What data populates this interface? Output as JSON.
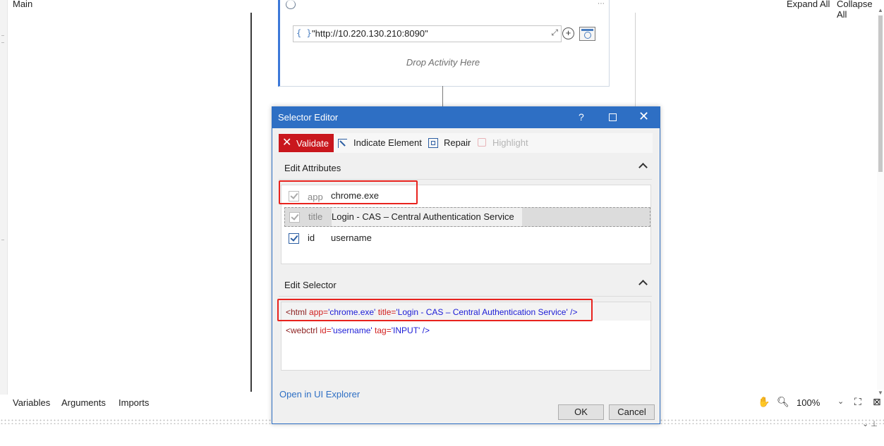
{
  "designer": {
    "title": "Main",
    "expand_all": "Expand All",
    "collapse_all": "Collapse All",
    "url_value": "\"http://10.220.130.210:8090\"",
    "drop_text": "Drop Activity Here"
  },
  "bottom_bar": {
    "tabs": [
      "Variables",
      "Arguments",
      "Imports"
    ],
    "zoom": "100%"
  },
  "dialog": {
    "title": "Selector Editor",
    "help": "?",
    "toolbar": {
      "validate": "Validate",
      "indicate": "Indicate Element",
      "repair": "Repair",
      "highlight": "Highlight"
    },
    "edit_attributes": {
      "header": "Edit Attributes",
      "rows": [
        {
          "name": "app",
          "value": "chrome.exe",
          "checked": true,
          "enabled": false
        },
        {
          "name": "title",
          "value": "Login - CAS – Central Authentication Service",
          "checked": true,
          "enabled": false
        },
        {
          "name": "id",
          "value": "username",
          "checked": true,
          "enabled": true
        }
      ]
    },
    "edit_selector": {
      "header": "Edit Selector",
      "line1": {
        "open": "<html",
        "attr1": "app=",
        "val1": "'chrome.exe'",
        "attr2": "title=",
        "val2": "'Login - CAS – Central Authentication Service'",
        "close": "/>"
      },
      "line2": {
        "open": "<webctrl",
        "attr1": "id=",
        "val1": "'username'",
        "attr2": "tag=",
        "val2": "'INPUT'",
        "close": "/>"
      }
    },
    "open_ui_explorer": "Open in UI Explorer",
    "ok": "OK",
    "cancel": "Cancel"
  },
  "colors": {
    "accent": "#2e6fc4",
    "validate_bg": "#c9171d",
    "highlight_box": "#e8231e"
  }
}
